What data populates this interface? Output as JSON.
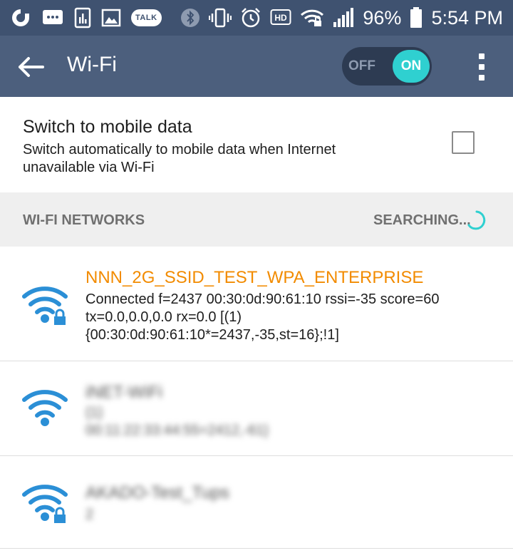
{
  "status_bar": {
    "battery_percent": "96%",
    "time": "5:54 PM",
    "talk_label": "TALK",
    "hd_label": "HD",
    "icons_left": [
      "app-o-icon",
      "message-icon",
      "chart-icon",
      "image-icon",
      "talk-icon"
    ],
    "icons_right": [
      "bluetooth-icon",
      "vibrate-icon",
      "alarm-icon",
      "hd-icon",
      "wifi-lock-icon",
      "signal-icon",
      "battery-icon"
    ]
  },
  "app_bar": {
    "title": "Wi-Fi",
    "toggle_off_label": "OFF",
    "toggle_on_label": "ON",
    "toggle_state": "on"
  },
  "mobile_data": {
    "title": "Switch to mobile data",
    "subtitle": "Switch automatically to mobile data when Internet unavailable via Wi-Fi",
    "checked": false
  },
  "networks_header": {
    "title": "WI-FI NETWORKS",
    "status": "SEARCHING..."
  },
  "networks": [
    {
      "name": "NNN_2G_SSID_TEST_WPA_ENTERPRISE",
      "line1": "Connected f=2437  00:30:0d:90:61:10 rssi=-35  score=60",
      "line2": "tx=0.0,0.0,0.0 rx=0.0 [(1)",
      "line3": "{00:30:0d:90:61:10*=2437,-35,st=16};!1]",
      "secured": true,
      "connected": true
    },
    {
      "name": "iNET-WiFi",
      "line1": "{1}",
      "line2": "00:11:22:33:44:55=2412,-61}",
      "secured": false,
      "connected": false
    },
    {
      "name": "AKADO-Test_Tups",
      "line1": "2",
      "secured": true,
      "connected": false
    }
  ],
  "colors": {
    "status_bar_bg": "#3f5270",
    "app_bar_bg": "#4c5f7d",
    "accent_teal": "#2fd0d0",
    "connected_name": "#f28b00",
    "wifi_icon": "#2b8fd6"
  }
}
